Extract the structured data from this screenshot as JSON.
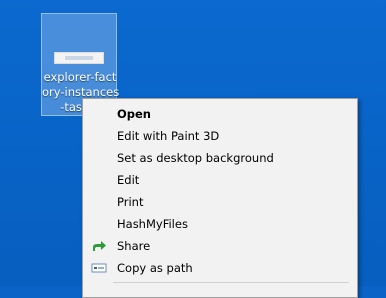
{
  "desktop_icon": {
    "label": "explorer-fact\nory-instances\n-taskm"
  },
  "context_menu": {
    "items": [
      {
        "label": "Open",
        "bold": true
      },
      {
        "label": "Edit with Paint 3D"
      },
      {
        "label": "Set as desktop background"
      },
      {
        "label": "Edit"
      },
      {
        "label": "Print"
      },
      {
        "label": "HashMyFiles"
      },
      {
        "label": "Share",
        "icon": "share-icon"
      },
      {
        "label": "Copy as path",
        "icon": "copy-path-icon"
      }
    ]
  },
  "colors": {
    "desktop_background": "#0863c6",
    "menu_background": "#f2f2f2",
    "share_icon": "#2e9b3a"
  }
}
